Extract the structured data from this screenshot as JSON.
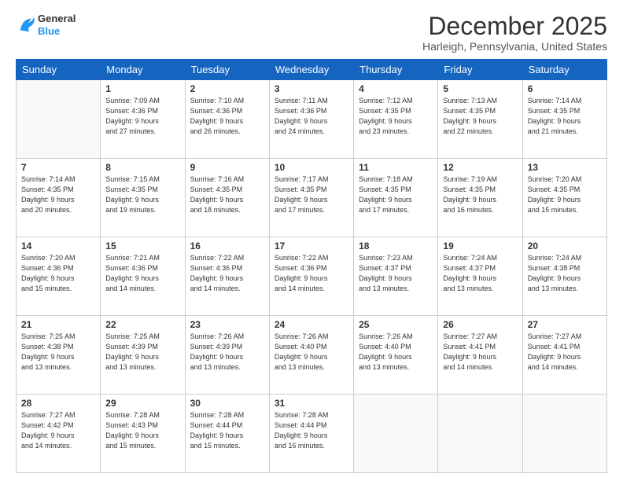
{
  "header": {
    "logo_line1": "General",
    "logo_line2": "Blue",
    "month": "December 2025",
    "location": "Harleigh, Pennsylvania, United States"
  },
  "days_of_week": [
    "Sunday",
    "Monday",
    "Tuesday",
    "Wednesday",
    "Thursday",
    "Friday",
    "Saturday"
  ],
  "weeks": [
    [
      {
        "day": "",
        "info": ""
      },
      {
        "day": "1",
        "info": "Sunrise: 7:09 AM\nSunset: 4:36 PM\nDaylight: 9 hours\nand 27 minutes."
      },
      {
        "day": "2",
        "info": "Sunrise: 7:10 AM\nSunset: 4:36 PM\nDaylight: 9 hours\nand 26 minutes."
      },
      {
        "day": "3",
        "info": "Sunrise: 7:11 AM\nSunset: 4:36 PM\nDaylight: 9 hours\nand 24 minutes."
      },
      {
        "day": "4",
        "info": "Sunrise: 7:12 AM\nSunset: 4:35 PM\nDaylight: 9 hours\nand 23 minutes."
      },
      {
        "day": "5",
        "info": "Sunrise: 7:13 AM\nSunset: 4:35 PM\nDaylight: 9 hours\nand 22 minutes."
      },
      {
        "day": "6",
        "info": "Sunrise: 7:14 AM\nSunset: 4:35 PM\nDaylight: 9 hours\nand 21 minutes."
      }
    ],
    [
      {
        "day": "7",
        "info": "Sunrise: 7:14 AM\nSunset: 4:35 PM\nDaylight: 9 hours\nand 20 minutes."
      },
      {
        "day": "8",
        "info": "Sunrise: 7:15 AM\nSunset: 4:35 PM\nDaylight: 9 hours\nand 19 minutes."
      },
      {
        "day": "9",
        "info": "Sunrise: 7:16 AM\nSunset: 4:35 PM\nDaylight: 9 hours\nand 18 minutes."
      },
      {
        "day": "10",
        "info": "Sunrise: 7:17 AM\nSunset: 4:35 PM\nDaylight: 9 hours\nand 17 minutes."
      },
      {
        "day": "11",
        "info": "Sunrise: 7:18 AM\nSunset: 4:35 PM\nDaylight: 9 hours\nand 17 minutes."
      },
      {
        "day": "12",
        "info": "Sunrise: 7:19 AM\nSunset: 4:35 PM\nDaylight: 9 hours\nand 16 minutes."
      },
      {
        "day": "13",
        "info": "Sunrise: 7:20 AM\nSunset: 4:35 PM\nDaylight: 9 hours\nand 15 minutes."
      }
    ],
    [
      {
        "day": "14",
        "info": "Sunrise: 7:20 AM\nSunset: 4:36 PM\nDaylight: 9 hours\nand 15 minutes."
      },
      {
        "day": "15",
        "info": "Sunrise: 7:21 AM\nSunset: 4:36 PM\nDaylight: 9 hours\nand 14 minutes."
      },
      {
        "day": "16",
        "info": "Sunrise: 7:22 AM\nSunset: 4:36 PM\nDaylight: 9 hours\nand 14 minutes."
      },
      {
        "day": "17",
        "info": "Sunrise: 7:22 AM\nSunset: 4:36 PM\nDaylight: 9 hours\nand 14 minutes."
      },
      {
        "day": "18",
        "info": "Sunrise: 7:23 AM\nSunset: 4:37 PM\nDaylight: 9 hours\nand 13 minutes."
      },
      {
        "day": "19",
        "info": "Sunrise: 7:24 AM\nSunset: 4:37 PM\nDaylight: 9 hours\nand 13 minutes."
      },
      {
        "day": "20",
        "info": "Sunrise: 7:24 AM\nSunset: 4:38 PM\nDaylight: 9 hours\nand 13 minutes."
      }
    ],
    [
      {
        "day": "21",
        "info": "Sunrise: 7:25 AM\nSunset: 4:38 PM\nDaylight: 9 hours\nand 13 minutes."
      },
      {
        "day": "22",
        "info": "Sunrise: 7:25 AM\nSunset: 4:39 PM\nDaylight: 9 hours\nand 13 minutes."
      },
      {
        "day": "23",
        "info": "Sunrise: 7:26 AM\nSunset: 4:39 PM\nDaylight: 9 hours\nand 13 minutes."
      },
      {
        "day": "24",
        "info": "Sunrise: 7:26 AM\nSunset: 4:40 PM\nDaylight: 9 hours\nand 13 minutes."
      },
      {
        "day": "25",
        "info": "Sunrise: 7:26 AM\nSunset: 4:40 PM\nDaylight: 9 hours\nand 13 minutes."
      },
      {
        "day": "26",
        "info": "Sunrise: 7:27 AM\nSunset: 4:41 PM\nDaylight: 9 hours\nand 14 minutes."
      },
      {
        "day": "27",
        "info": "Sunrise: 7:27 AM\nSunset: 4:41 PM\nDaylight: 9 hours\nand 14 minutes."
      }
    ],
    [
      {
        "day": "28",
        "info": "Sunrise: 7:27 AM\nSunset: 4:42 PM\nDaylight: 9 hours\nand 14 minutes."
      },
      {
        "day": "29",
        "info": "Sunrise: 7:28 AM\nSunset: 4:43 PM\nDaylight: 9 hours\nand 15 minutes."
      },
      {
        "day": "30",
        "info": "Sunrise: 7:28 AM\nSunset: 4:44 PM\nDaylight: 9 hours\nand 15 minutes."
      },
      {
        "day": "31",
        "info": "Sunrise: 7:28 AM\nSunset: 4:44 PM\nDaylight: 9 hours\nand 16 minutes."
      },
      {
        "day": "",
        "info": ""
      },
      {
        "day": "",
        "info": ""
      },
      {
        "day": "",
        "info": ""
      }
    ]
  ]
}
